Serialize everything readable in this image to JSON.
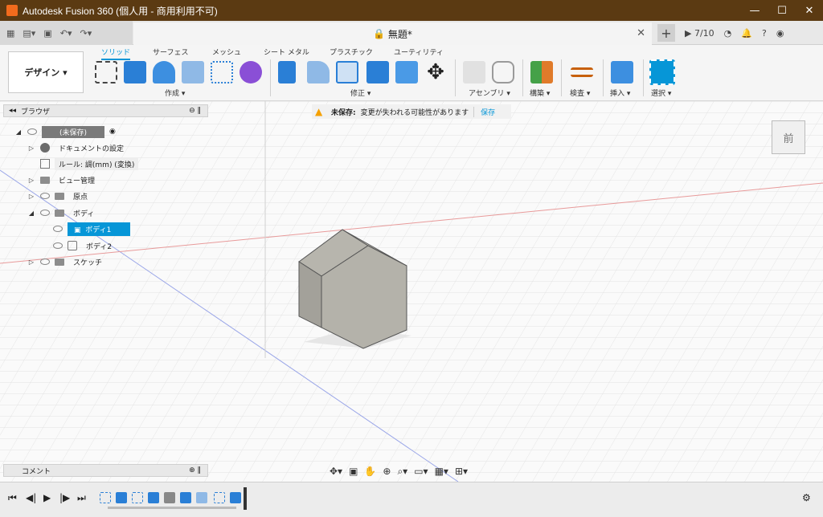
{
  "window": {
    "title": "Autodesk Fusion 360 (個人用 - 商用利用不可)"
  },
  "doc_tab": {
    "title": "無題*",
    "jobs": "7/10"
  },
  "workspace": {
    "label": "デザイン ▾"
  },
  "ribbon_tabs": [
    {
      "label": "ソリッド",
      "active": true
    },
    {
      "label": "サーフェス"
    },
    {
      "label": "メッシュ"
    },
    {
      "label": "シート メタル"
    },
    {
      "label": "プラスチック"
    },
    {
      "label": "ユーティリティ"
    }
  ],
  "ribbon_groups": [
    "作成 ▾",
    "修正 ▾",
    "アセンブリ ▾",
    "構築 ▾",
    "検査 ▾",
    "挿入 ▾",
    "選択 ▾"
  ],
  "browser": {
    "title": "ブラウザ",
    "root": "(未保存)",
    "items": [
      "ドキュメントの設定",
      "ルール: 調(mm) (変換)",
      "ビュー管理",
      "原点",
      "ボディ",
      "ボディ1",
      "ボディ2",
      "スケッチ"
    ]
  },
  "notice": {
    "label": "未保存:",
    "message": "変更が失われる可能性があります",
    "action": "保存"
  },
  "comments": {
    "label": "コメント"
  },
  "viewcube": {
    "face": "前"
  },
  "colors": {
    "accent": "#0696d7",
    "titlebar": "#5b3a12",
    "warning": "#f5a000"
  }
}
